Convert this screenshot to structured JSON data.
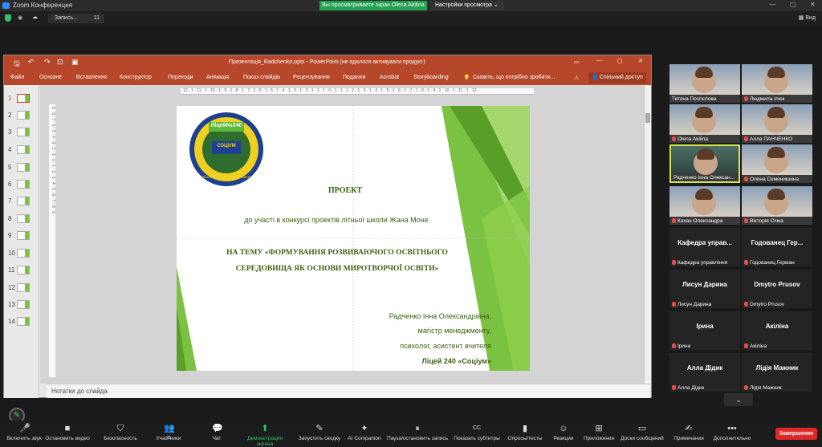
{
  "window": {
    "title": "Zoom Конференция",
    "share_banner": "Вы просматриваете экран Olena Akilina",
    "view_options": "Настройки просмотра",
    "recording_label": "Запись...",
    "recording_count": "11",
    "view_label": "Вид"
  },
  "ppt": {
    "filename": "Презентація_Radchenko.pptx - PowerPoint (не вдалося активувати продукт)",
    "tabs": [
      "Файл",
      "Основне",
      "Вставлення",
      "Конструктор",
      "Переходи",
      "Анімація",
      "Показ слайдів",
      "Рецензування",
      "Подання",
      "Acrobat",
      "Storyboarding"
    ],
    "tell_me": "Скажіть, що потрібно зробити...",
    "share": "Спільний доступ",
    "notes_placeholder": "Нотатки до слайда",
    "thumb_numbers": [
      "1",
      "2",
      "3",
      "4",
      "5",
      "6",
      "7",
      "8",
      "9",
      "10",
      "11",
      "12",
      "13",
      "14"
    ],
    "hruler": "· 12 · 1 · 11 · 1 · 10 · 1 · 9 · 1 · 8 · 1 · 7 · 1 · 6 · 1 · 5 · 1 · 4 · 1 · 3 · 1 · 2 · 1 · 1 · 1 · 0 · 1 · 1 · 1 · 2 · 1 · 3 · 1 · 4 · 1 · 5 · 1 · 6 · 1 · 7 · 1 · 8 · 1 · 9 · 1 · 10 · 1 · 11 · 1 · 12 ·",
    "vruler": "· 9 · 8 · 7 · 6 · 5 · 4 · 3 · 2 · 1 · 0 · 1 · 2 · 3 · 4 · 5 · 6 · 7 · 8 · 9 ·"
  },
  "slide": {
    "logo_top": "Ліцей№240",
    "logo_mid": "СОЦІУМ",
    "logo_arc": "Оболонського району м.Києва",
    "line1": "ПРОЕКТ",
    "line2": "до участі в конкурсі проектів літньої школи Жана Моне",
    "line3": "НА ТЕМУ «ФОРМУВАННЯ РОЗВИВАЮЧОГО ОСВІТНЬОГО",
    "line4": "СЕРЕДОВИЩА ЯК ОСНОВИ МИРОТВОРЧОЇ ОСВІТИ»",
    "author1": "Радченко Інна Олександрівна,",
    "author2": "магістр менеджменту,",
    "author3": "психолог, асистент вчителя",
    "author4": "Ліцей 240 «Соціум»"
  },
  "participants": [
    {
      "name": "Тетяна Поспєлова",
      "big": "",
      "video": true,
      "muted": false
    },
    {
      "name": "Людмила Ілюк",
      "big": "",
      "video": true,
      "muted": true
    },
    {
      "name": "Olena Akilina",
      "big": "",
      "video": true,
      "muted": true
    },
    {
      "name": "Алла ПАНЧЕНКО",
      "big": "",
      "video": true,
      "muted": true
    },
    {
      "name": "Радченко Інна Олексан...",
      "big": "",
      "video": true,
      "muted": false
    },
    {
      "name": "Олена Семенишина",
      "big": "",
      "video": true,
      "muted": true
    },
    {
      "name": "Кохан Олександра",
      "big": "",
      "video": true,
      "muted": true
    },
    {
      "name": "Вікторія Січка",
      "big": "",
      "video": true,
      "muted": true
    },
    {
      "name": "Кафедра управління",
      "big": "Кафедра управ...",
      "video": false,
      "muted": true
    },
    {
      "name": "Годованец Герман",
      "big": "Годованец Гер...",
      "video": false,
      "muted": true
    },
    {
      "name": "Лисун Дарина",
      "big": "Лисун Дарина",
      "video": false,
      "muted": true
    },
    {
      "name": "Dmytro Prusov",
      "big": "Dmytro Prusov",
      "video": false,
      "muted": true
    },
    {
      "name": "Ірина",
      "big": "Ірина",
      "video": false,
      "muted": true
    },
    {
      "name": "Акіліна",
      "big": "Акіліна",
      "video": false,
      "muted": true
    },
    {
      "name": "Алла Дідик",
      "big": "Алла Дідик",
      "video": false,
      "muted": true
    },
    {
      "name": "Лідія Мажник",
      "big": "Лідія Мажник",
      "video": false,
      "muted": true
    }
  ],
  "toolbar": {
    "items": [
      {
        "label": "Включить звук",
        "icon": "🎤"
      },
      {
        "label": "Остановить видео",
        "icon": "■"
      },
      {
        "label": "Безопасность",
        "icon": "⛉"
      },
      {
        "label": "Участники",
        "icon": "👥",
        "count": "25"
      },
      {
        "label": "Чат",
        "icon": "💬"
      },
      {
        "label": "Демонстрация экрана",
        "icon": "⬆"
      },
      {
        "label": "Запустить сводку",
        "icon": "✎"
      },
      {
        "label": "AI Companion",
        "icon": "✦"
      },
      {
        "label": "Пауза/остановить запись",
        "icon": "⏸"
      },
      {
        "label": "Показать субтитры",
        "icon": "CC"
      },
      {
        "label": "Опросы/тесты",
        "icon": "▮"
      },
      {
        "label": "Реакции",
        "icon": "☺"
      },
      {
        "label": "Приложения",
        "icon": "⊞"
      },
      {
        "label": "Доски сообщений",
        "icon": "▭"
      },
      {
        "label": "Примечания",
        "icon": "✍"
      },
      {
        "label": "Дополнительно",
        "icon": "•••"
      }
    ],
    "end": "Завершение"
  },
  "colors": {
    "ppt_brand": "#b7472a",
    "slide_green": "#3b5f12",
    "share_green": "#23a050",
    "end_red": "#e02828"
  }
}
